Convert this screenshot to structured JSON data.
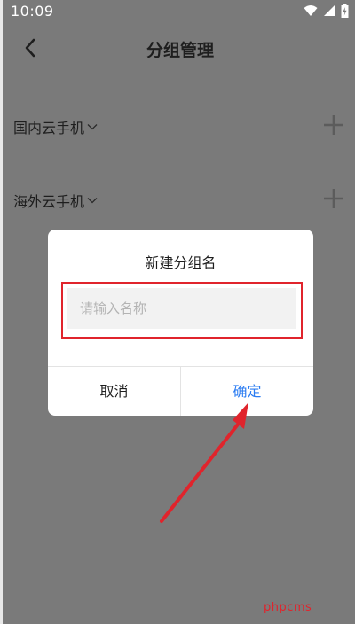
{
  "status_bar": {
    "time": "10:09",
    "icons": [
      "wifi-icon",
      "cellular-signal-icon",
      "battery-icon"
    ]
  },
  "header": {
    "title": "分组管理",
    "back_icon": "chevron-left-icon"
  },
  "groups": [
    {
      "label": "国内云手机",
      "expand_icon": "chevron-down-icon",
      "add_icon": "plus-icon"
    },
    {
      "label": "海外云手机",
      "expand_icon": "chevron-down-icon",
      "add_icon": "plus-icon"
    }
  ],
  "dialog": {
    "title": "新建分组名",
    "input": {
      "value": "",
      "placeholder": "请输入名称"
    },
    "cancel_label": "取消",
    "confirm_label": "确定"
  },
  "watermark": "phpcms",
  "colors": {
    "overlay_background": "#7a7a7a",
    "accent": "#2b7cf2",
    "highlight_red": "#e0242c",
    "dialog_background": "#ffffff"
  }
}
